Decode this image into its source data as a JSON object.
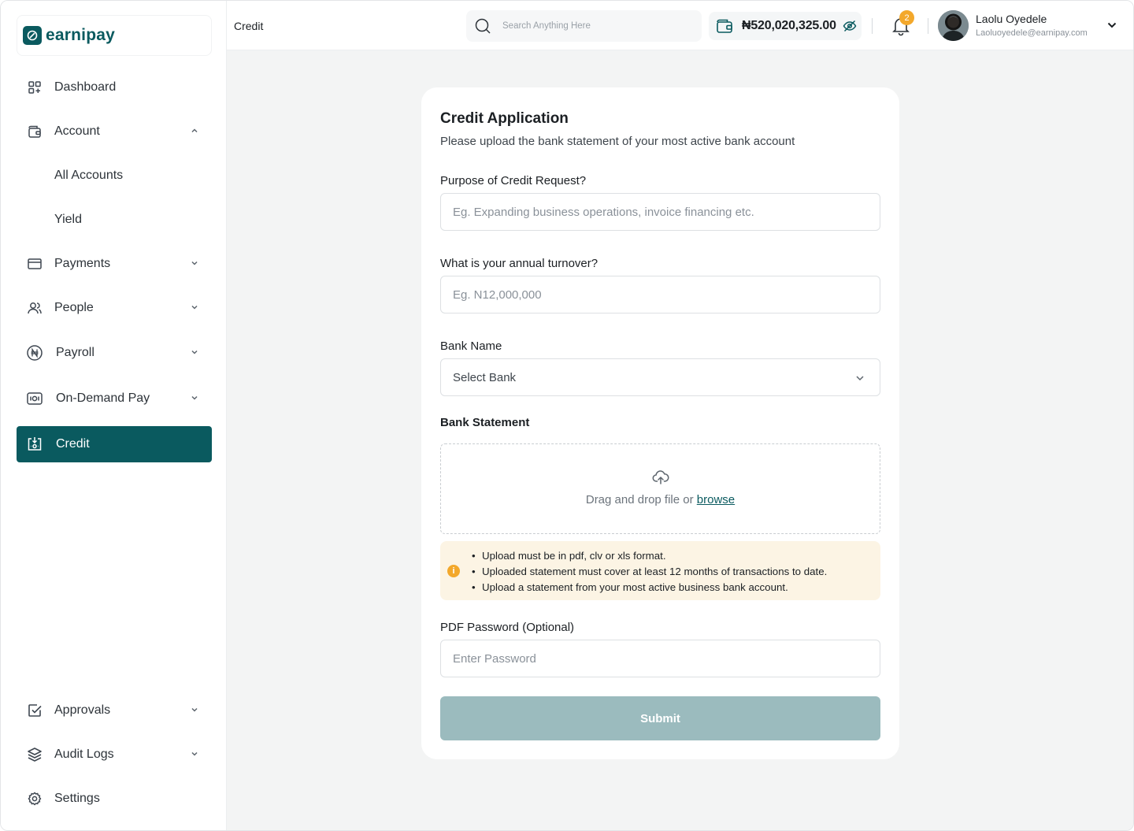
{
  "app": {
    "logo_text": "earnipay",
    "brand_color": "#0a5a5f"
  },
  "sidebar": {
    "items": [
      {
        "label": "Dashboard",
        "icon": "dashboard-icon"
      },
      {
        "label": "Account",
        "icon": "wallet-icon",
        "expanded": true
      },
      {
        "label": "Payments",
        "icon": "card-icon"
      },
      {
        "label": "People",
        "icon": "people-icon"
      },
      {
        "label": "Payroll",
        "icon": "naira-circle-icon"
      },
      {
        "label": "On-Demand Pay",
        "icon": "cash-icon"
      },
      {
        "label": "Credit",
        "icon": "credit-icon",
        "active": true
      }
    ],
    "account_sub": [
      "All Accounts",
      "Yield"
    ],
    "bottom_items": [
      {
        "label": "Approvals",
        "icon": "checkbox-icon"
      },
      {
        "label": "Audit Logs",
        "icon": "layers-icon"
      },
      {
        "label": "Settings",
        "icon": "gear-icon"
      }
    ]
  },
  "header": {
    "breadcrumb": "Credit",
    "search_placeholder": "Search Anything Here",
    "balance": "₦520,020,325.00",
    "notification_count": "2",
    "user_name": "Laolu Oyedele",
    "user_email": "Laoluoyedele@earnipay.com"
  },
  "form": {
    "title": "Credit Application",
    "subtitle": "Please upload the bank statement of your most active bank account",
    "purpose_label": "Purpose of Credit Request?",
    "purpose_placeholder": "Eg. Expanding business operations, invoice financing etc.",
    "turnover_label": "What is your annual turnover?",
    "turnover_placeholder": "Eg. N12,000,000",
    "bank_label": "Bank Name",
    "bank_value": "Select Bank",
    "statement_label": "Bank Statement",
    "drop_text": "Drag and drop file or",
    "browse_text": "browse",
    "notes": [
      "Upload must be in pdf, clv or xls format.",
      "Uploaded statement must cover at least 12 months of transactions to date.",
      "Upload a statement from your most active business bank account."
    ],
    "password_label": "PDF Password (Optional)",
    "password_placeholder": "Enter Password",
    "submit_label": "Submit"
  }
}
